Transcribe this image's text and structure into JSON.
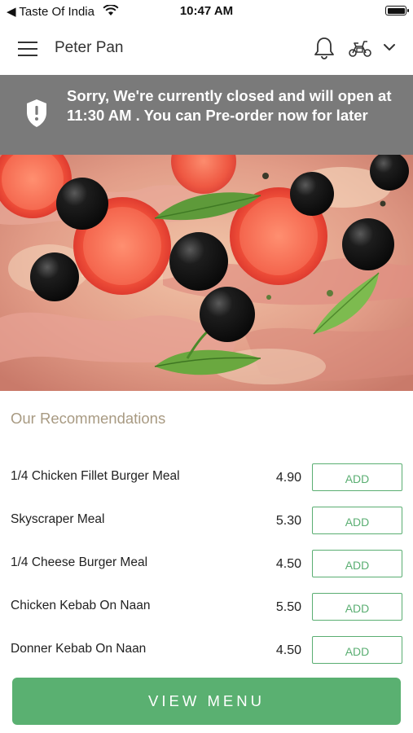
{
  "status_bar": {
    "back_label": "◀ Taste Of India",
    "time": "10:47 AM"
  },
  "header": {
    "title": "Peter Pan"
  },
  "notice": {
    "message": "Sorry, We're currently closed and will open at 11:30 AM . You can Pre-order now for later"
  },
  "recommendations": {
    "title": "Our Recommendations",
    "items": [
      {
        "name": "1/4  Chicken Fillet Burger Meal",
        "price": "4.90",
        "button": "ADD"
      },
      {
        "name": "Skyscraper Meal",
        "price": "5.30",
        "button": "ADD"
      },
      {
        "name": "1/4 Cheese Burger Meal",
        "price": "4.50",
        "button": "ADD"
      },
      {
        "name": "Chicken Kebab On Naan",
        "price": "5.50",
        "button": "ADD"
      },
      {
        "name": "Donner Kebab On Naan",
        "price": "4.50",
        "button": "ADD"
      }
    ]
  },
  "footer": {
    "view_menu_label": "VIEW MENU"
  },
  "colors": {
    "accent": "#5ab071",
    "notice_bg": "#7a7a7a",
    "section_title": "#a89a82"
  },
  "icons": [
    "menu-icon",
    "bell-icon",
    "scooter-icon",
    "chevron-down-icon",
    "shield-icon",
    "wifi-icon",
    "battery-icon"
  ]
}
